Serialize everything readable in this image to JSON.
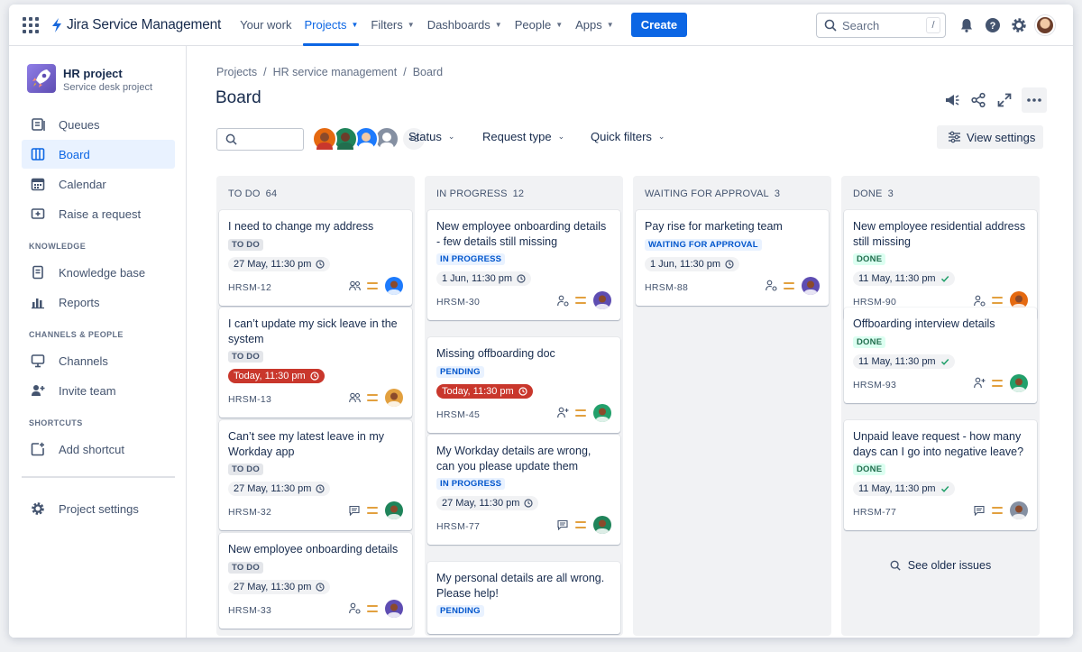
{
  "topnav": {
    "app_name": "Jira Service Management",
    "items": [
      {
        "label": "Your work",
        "dropdown": false,
        "active": false
      },
      {
        "label": "Projects",
        "dropdown": true,
        "active": true
      },
      {
        "label": "Filters",
        "dropdown": true,
        "active": false
      },
      {
        "label": "Dashboards",
        "dropdown": true,
        "active": false
      },
      {
        "label": "People",
        "dropdown": true,
        "active": false
      },
      {
        "label": "Apps",
        "dropdown": true,
        "active": false
      }
    ],
    "create_label": "Create",
    "search_placeholder": "Search",
    "search_shortcut": "/",
    "icons": [
      "bell-icon",
      "help-icon",
      "settings-icon"
    ]
  },
  "sidebar": {
    "project_name": "HR project",
    "project_type": "Service desk project",
    "items": [
      {
        "label": "Queues",
        "icon": "queues-icon"
      },
      {
        "label": "Board",
        "icon": "board-icon",
        "active": true
      },
      {
        "label": "Calendar",
        "icon": "calendar-icon"
      },
      {
        "label": "Raise a request",
        "icon": "raise-request-icon"
      }
    ],
    "knowledge_heading": "KNOWLEDGE",
    "knowledge_items": [
      {
        "label": "Knowledge base",
        "icon": "knowledge-base-icon"
      },
      {
        "label": "Reports",
        "icon": "reports-icon"
      }
    ],
    "channels_heading": "CHANNELS & PEOPLE",
    "channels_items": [
      {
        "label": "Channels",
        "icon": "channels-icon"
      },
      {
        "label": "Invite team",
        "icon": "invite-team-icon"
      }
    ],
    "shortcuts_heading": "SHORTCUTS",
    "shortcut_items": [
      {
        "label": "Add shortcut",
        "icon": "add-shortcut-icon"
      }
    ],
    "settings_label": "Project settings"
  },
  "breadcrumb": [
    "Projects",
    "HR service management",
    "Board"
  ],
  "page_title": "Board",
  "filters": {
    "avatars_more": "+3",
    "status_label": "Status",
    "request_type_label": "Request type",
    "quick_filters_label": "Quick filters",
    "view_settings_label": "View settings"
  },
  "columns": [
    {
      "title": "TO DO",
      "count": "64",
      "cards": [
        {
          "title": "I need to change my address",
          "status": "TO DO",
          "status_kind": "todo",
          "date": "27 May, 11:30 pm",
          "overdue": false,
          "key": "HRSM-12",
          "type_icon": "people-icon",
          "avatar_color": "#1d7afc"
        },
        {
          "title": "I can’t update my sick leave in the system",
          "status": "TO DO",
          "status_kind": "todo",
          "date": "Today, 11:30 pm",
          "overdue": true,
          "key": "HRSM-13",
          "type_icon": "people-icon",
          "avatar_color": "#e2a03f"
        },
        {
          "title": "Can’t see my latest leave in my Workday app",
          "status": "TO DO",
          "status_kind": "todo",
          "date": "27 May, 11:30 pm",
          "overdue": false,
          "key": "HRSM-32",
          "type_icon": "comment-icon",
          "avatar_color": "#1f845a"
        },
        {
          "title": "New employee onboarding details",
          "status": "TO DO",
          "status_kind": "todo",
          "date": "27 May, 11:30 pm",
          "overdue": false,
          "key": "HRSM-33",
          "type_icon": "person-gear-icon",
          "avatar_color": "#5e4db2"
        }
      ]
    },
    {
      "title": "IN PROGRESS",
      "count": "12",
      "cards": [
        {
          "title": "New employee onboarding details - few details still missing",
          "status": "IN PROGRESS",
          "status_kind": "progress",
          "date": "1 Jun, 11:30 pm",
          "overdue": false,
          "key": "HRSM-30",
          "type_icon": "person-gear-icon",
          "avatar_color": "#5e4db2"
        },
        {
          "title": "Missing offboarding doc",
          "status": "PENDING",
          "status_kind": "pending",
          "date": "Today, 11:30 pm",
          "overdue": true,
          "key": "HRSM-45",
          "type_icon": "person-add-icon",
          "avatar_color": "#22a06b"
        },
        {
          "title": "My Workday details are wrong, can you please update them",
          "status": "IN PROGRESS",
          "status_kind": "progress",
          "date": "27 May, 11:30 pm",
          "overdue": false,
          "key": "HRSM-77",
          "type_icon": "comment-icon",
          "avatar_color": "#1f845a"
        },
        {
          "title": "My personal details are all wrong. Please help!",
          "status": "PENDING",
          "status_kind": "pending",
          "date": "",
          "overdue": false,
          "key": "",
          "type_icon": "",
          "avatar_color": "#5e4db2"
        }
      ]
    },
    {
      "title": "WAITING FOR APPROVAL",
      "count": "3",
      "cards": [
        {
          "title": "Pay rise for marketing team",
          "status": "WAITING FOR APPROVAL",
          "status_kind": "approval",
          "date": "1 Jun, 11:30 pm",
          "overdue": false,
          "key": "HRSM-88",
          "type_icon": "person-gear-icon",
          "avatar_color": "#5e4db2"
        }
      ]
    },
    {
      "title": "DONE",
      "count": "3",
      "cards": [
        {
          "title": "New employee residential address still  missing",
          "status": "DONE",
          "status_kind": "done",
          "date": "11 May, 11:30 pm",
          "overdue": false,
          "key": "HRSM-90",
          "type_icon": "person-gear-icon",
          "avatar_color": "#e56910"
        },
        {
          "title": "Offboarding interview details",
          "status": "DONE",
          "status_kind": "done",
          "date": "11 May, 11:30 pm",
          "overdue": false,
          "key": "HRSM-93",
          "type_icon": "person-add-icon",
          "avatar_color": "#22a06b"
        },
        {
          "title": "Unpaid leave request - how many days can I go into negative leave?",
          "status": "DONE",
          "status_kind": "done",
          "date": "11 May, 11:30 pm",
          "overdue": false,
          "key": "HRSM-77",
          "type_icon": "comment-icon",
          "avatar_color": "#8590a2"
        }
      ],
      "see_older_label": "See older issues"
    }
  ]
}
